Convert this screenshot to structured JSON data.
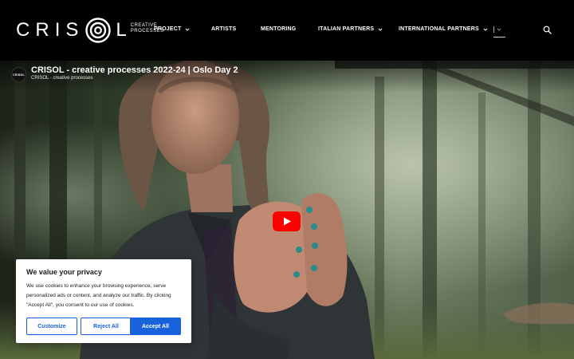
{
  "header": {
    "logo_text": "CRISOL",
    "logo_sub_line1": "CREATIVE",
    "logo_sub_line2": "PROCESSES",
    "nav": [
      {
        "label": "PROJECT",
        "dropdown": true
      },
      {
        "label": "ARTISTS",
        "dropdown": false
      },
      {
        "label": "MENTORING",
        "dropdown": false
      },
      {
        "label": "ITALIAN PARTNERS",
        "dropdown": true
      },
      {
        "label": "INTERNATIONAL PARTNERS",
        "dropdown": true
      }
    ],
    "language_icon": "chevron-down-icon",
    "search_icon": "search-icon"
  },
  "video": {
    "title": "CRISOL - creative processes 2022-24 | Oslo Day 2",
    "channel": "CRISOL - creative processes",
    "avatar_text": "CRISOL",
    "play_icon": "youtube-play-icon"
  },
  "cookie": {
    "title": "We value your privacy",
    "text": "We use cookies to enhance your browsing experience, serve personalized ads or content, and analyze our traffic. By clicking \"Accept All\", you consent to our use of cookies.",
    "customize": "Customize",
    "reject": "Reject All",
    "accept": "Accept All",
    "accent_color": "#1863dc"
  }
}
